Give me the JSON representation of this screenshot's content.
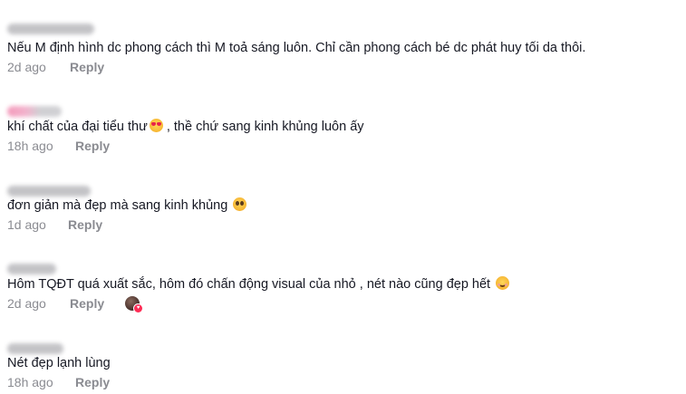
{
  "comments": [
    {
      "text": "Nếu M định hình dc phong cách thì M toả sáng luôn. Chỉ cần phong cách bé dc phát huy tối da thôi.",
      "time": "2d ago",
      "reply": "Reply"
    },
    {
      "text": "khí chất của đại tiểu thư",
      "text_after": ", thề chứ sang kinh khủng luôn ấy",
      "emoji": "smiling-face-with-heart-eyes",
      "time": "18h ago",
      "reply": "Reply"
    },
    {
      "text": "đơn giản mà đẹp mà sang kinh khủng",
      "emoji": "pleading-face",
      "time": "1d ago",
      "reply": "Reply"
    },
    {
      "text": "Hôm TQĐT quá xuất sắc, hôm đó chấn động visual của nhỏ , nét nào cũng đẹp hết",
      "emoji": "smiling-face-with-smiling-eyes",
      "time": "2d ago",
      "reply": "Reply",
      "creator_liked": true
    },
    {
      "text": "Nét đẹp lạnh lùng",
      "time": "18h ago",
      "reply": "Reply"
    }
  ],
  "icons": {
    "creator_like_badge": "heart-icon"
  },
  "colors": {
    "text": "#161823",
    "meta": "#8a8b91",
    "like_badge": "#fe2c55"
  }
}
